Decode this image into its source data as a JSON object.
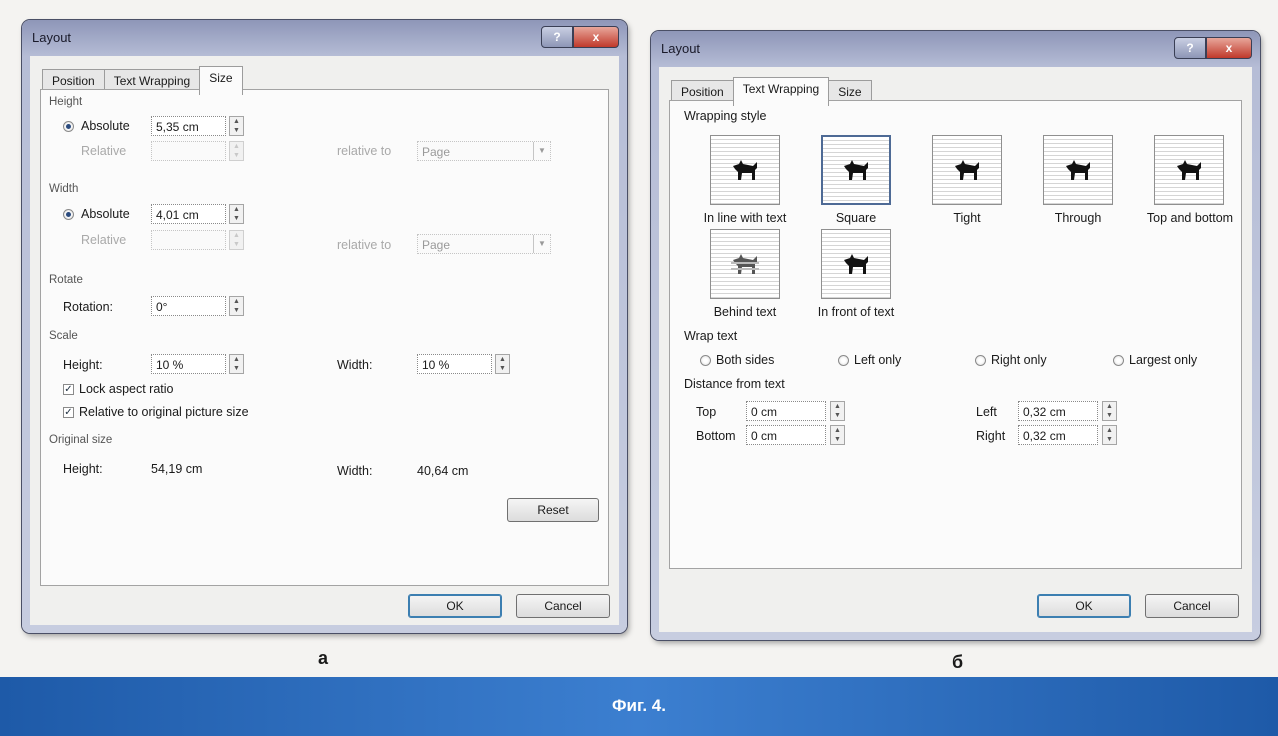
{
  "dialog_a": {
    "title": "Layout",
    "help_glyph": "?",
    "close_glyph": "x",
    "tabs": [
      "Position",
      "Text Wrapping",
      "Size"
    ],
    "active_tab": "Size",
    "height_section": "Height",
    "height_absolute_label": "Absolute",
    "height_absolute_value": "5,35 cm",
    "height_relative_label": "Relative",
    "height_relative_to_label": "relative to",
    "height_relative_to_value": "Page",
    "width_section": "Width",
    "width_absolute_label": "Absolute",
    "width_absolute_value": "4,01 cm",
    "width_relative_label": "Relative",
    "width_relative_to_label": "relative to",
    "width_relative_to_value": "Page",
    "rotate_section": "Rotate",
    "rotation_label": "Rotation:",
    "rotation_value": "0°",
    "scale_section": "Scale",
    "scale_height_label": "Height:",
    "scale_height_value": "10 %",
    "scale_width_label": "Width:",
    "scale_width_value": "10 %",
    "lock_aspect_label": "Lock aspect ratio",
    "relative_original_label": "Relative to original picture size",
    "original_size_section": "Original size",
    "orig_height_label": "Height:",
    "orig_height_value": "54,19 cm",
    "orig_width_label": "Width:",
    "orig_width_value": "40,64 cm",
    "reset_label": "Reset",
    "ok_label": "OK",
    "cancel_label": "Cancel"
  },
  "dialog_b": {
    "title": "Layout",
    "help_glyph": "?",
    "close_glyph": "x",
    "tabs": [
      "Position",
      "Text Wrapping",
      "Size"
    ],
    "active_tab": "Text Wrapping",
    "wrapping_style_section": "Wrapping style",
    "styles": [
      "In line with text",
      "Square",
      "Tight",
      "Through",
      "Top and bottom",
      "Behind text",
      "In front of text"
    ],
    "selected_style": "Square",
    "wrap_text_section": "Wrap text",
    "wrap_options": [
      "Both sides",
      "Left only",
      "Right only",
      "Largest only"
    ],
    "distance_section": "Distance from text",
    "top_label": "Top",
    "top_value": "0 cm",
    "bottom_label": "Bottom",
    "bottom_value": "0 cm",
    "left_label": "Left",
    "left_value": "0,32 cm",
    "right_label": "Right",
    "right_value": "0,32 cm",
    "ok_label": "OK",
    "cancel_label": "Cancel"
  },
  "captions": {
    "a": "а",
    "b": "б"
  },
  "figure_label": "Фиг. 4.",
  "colors": {
    "banner": "#2f6fc0",
    "dialog_frame": "#b6bdd6",
    "close_button": "#c0392b"
  }
}
